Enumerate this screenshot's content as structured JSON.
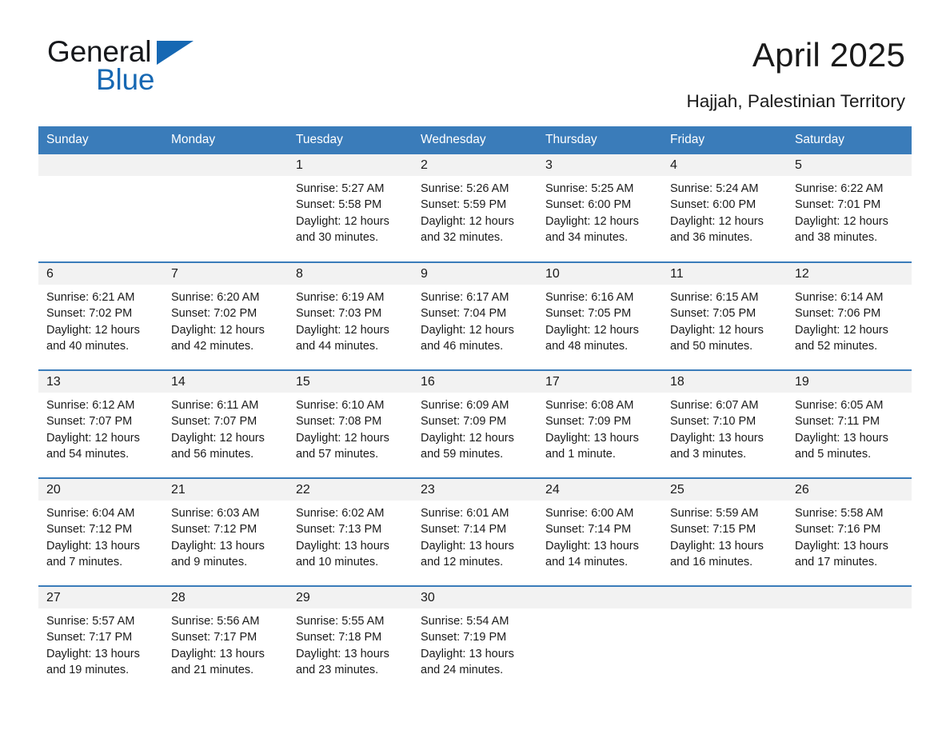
{
  "brand": {
    "name_part1": "General",
    "name_part2": "Blue",
    "triangle_color": "#1668b3",
    "accent_color": "#3a7cba"
  },
  "header": {
    "title": "April 2025",
    "subtitle": "Hajjah, Palestinian Territory"
  },
  "calendar": {
    "weekday_headers": [
      "Sunday",
      "Monday",
      "Tuesday",
      "Wednesday",
      "Thursday",
      "Friday",
      "Saturday"
    ],
    "weeks": [
      [
        {
          "day": "",
          "sunrise": "",
          "sunset": "",
          "daylight": ""
        },
        {
          "day": "",
          "sunrise": "",
          "sunset": "",
          "daylight": ""
        },
        {
          "day": "1",
          "sunrise": "Sunrise: 5:27 AM",
          "sunset": "Sunset: 5:58 PM",
          "daylight": "Daylight: 12 hours and 30 minutes."
        },
        {
          "day": "2",
          "sunrise": "Sunrise: 5:26 AM",
          "sunset": "Sunset: 5:59 PM",
          "daylight": "Daylight: 12 hours and 32 minutes."
        },
        {
          "day": "3",
          "sunrise": "Sunrise: 5:25 AM",
          "sunset": "Sunset: 6:00 PM",
          "daylight": "Daylight: 12 hours and 34 minutes."
        },
        {
          "day": "4",
          "sunrise": "Sunrise: 5:24 AM",
          "sunset": "Sunset: 6:00 PM",
          "daylight": "Daylight: 12 hours and 36 minutes."
        },
        {
          "day": "5",
          "sunrise": "Sunrise: 6:22 AM",
          "sunset": "Sunset: 7:01 PM",
          "daylight": "Daylight: 12 hours and 38 minutes."
        }
      ],
      [
        {
          "day": "6",
          "sunrise": "Sunrise: 6:21 AM",
          "sunset": "Sunset: 7:02 PM",
          "daylight": "Daylight: 12 hours and 40 minutes."
        },
        {
          "day": "7",
          "sunrise": "Sunrise: 6:20 AM",
          "sunset": "Sunset: 7:02 PM",
          "daylight": "Daylight: 12 hours and 42 minutes."
        },
        {
          "day": "8",
          "sunrise": "Sunrise: 6:19 AM",
          "sunset": "Sunset: 7:03 PM",
          "daylight": "Daylight: 12 hours and 44 minutes."
        },
        {
          "day": "9",
          "sunrise": "Sunrise: 6:17 AM",
          "sunset": "Sunset: 7:04 PM",
          "daylight": "Daylight: 12 hours and 46 minutes."
        },
        {
          "day": "10",
          "sunrise": "Sunrise: 6:16 AM",
          "sunset": "Sunset: 7:05 PM",
          "daylight": "Daylight: 12 hours and 48 minutes."
        },
        {
          "day": "11",
          "sunrise": "Sunrise: 6:15 AM",
          "sunset": "Sunset: 7:05 PM",
          "daylight": "Daylight: 12 hours and 50 minutes."
        },
        {
          "day": "12",
          "sunrise": "Sunrise: 6:14 AM",
          "sunset": "Sunset: 7:06 PM",
          "daylight": "Daylight: 12 hours and 52 minutes."
        }
      ],
      [
        {
          "day": "13",
          "sunrise": "Sunrise: 6:12 AM",
          "sunset": "Sunset: 7:07 PM",
          "daylight": "Daylight: 12 hours and 54 minutes."
        },
        {
          "day": "14",
          "sunrise": "Sunrise: 6:11 AM",
          "sunset": "Sunset: 7:07 PM",
          "daylight": "Daylight: 12 hours and 56 minutes."
        },
        {
          "day": "15",
          "sunrise": "Sunrise: 6:10 AM",
          "sunset": "Sunset: 7:08 PM",
          "daylight": "Daylight: 12 hours and 57 minutes."
        },
        {
          "day": "16",
          "sunrise": "Sunrise: 6:09 AM",
          "sunset": "Sunset: 7:09 PM",
          "daylight": "Daylight: 12 hours and 59 minutes."
        },
        {
          "day": "17",
          "sunrise": "Sunrise: 6:08 AM",
          "sunset": "Sunset: 7:09 PM",
          "daylight": "Daylight: 13 hours and 1 minute."
        },
        {
          "day": "18",
          "sunrise": "Sunrise: 6:07 AM",
          "sunset": "Sunset: 7:10 PM",
          "daylight": "Daylight: 13 hours and 3 minutes."
        },
        {
          "day": "19",
          "sunrise": "Sunrise: 6:05 AM",
          "sunset": "Sunset: 7:11 PM",
          "daylight": "Daylight: 13 hours and 5 minutes."
        }
      ],
      [
        {
          "day": "20",
          "sunrise": "Sunrise: 6:04 AM",
          "sunset": "Sunset: 7:12 PM",
          "daylight": "Daylight: 13 hours and 7 minutes."
        },
        {
          "day": "21",
          "sunrise": "Sunrise: 6:03 AM",
          "sunset": "Sunset: 7:12 PM",
          "daylight": "Daylight: 13 hours and 9 minutes."
        },
        {
          "day": "22",
          "sunrise": "Sunrise: 6:02 AM",
          "sunset": "Sunset: 7:13 PM",
          "daylight": "Daylight: 13 hours and 10 minutes."
        },
        {
          "day": "23",
          "sunrise": "Sunrise: 6:01 AM",
          "sunset": "Sunset: 7:14 PM",
          "daylight": "Daylight: 13 hours and 12 minutes."
        },
        {
          "day": "24",
          "sunrise": "Sunrise: 6:00 AM",
          "sunset": "Sunset: 7:14 PM",
          "daylight": "Daylight: 13 hours and 14 minutes."
        },
        {
          "day": "25",
          "sunrise": "Sunrise: 5:59 AM",
          "sunset": "Sunset: 7:15 PM",
          "daylight": "Daylight: 13 hours and 16 minutes."
        },
        {
          "day": "26",
          "sunrise": "Sunrise: 5:58 AM",
          "sunset": "Sunset: 7:16 PM",
          "daylight": "Daylight: 13 hours and 17 minutes."
        }
      ],
      [
        {
          "day": "27",
          "sunrise": "Sunrise: 5:57 AM",
          "sunset": "Sunset: 7:17 PM",
          "daylight": "Daylight: 13 hours and 19 minutes."
        },
        {
          "day": "28",
          "sunrise": "Sunrise: 5:56 AM",
          "sunset": "Sunset: 7:17 PM",
          "daylight": "Daylight: 13 hours and 21 minutes."
        },
        {
          "day": "29",
          "sunrise": "Sunrise: 5:55 AM",
          "sunset": "Sunset: 7:18 PM",
          "daylight": "Daylight: 13 hours and 23 minutes."
        },
        {
          "day": "30",
          "sunrise": "Sunrise: 5:54 AM",
          "sunset": "Sunset: 7:19 PM",
          "daylight": "Daylight: 13 hours and 24 minutes."
        },
        {
          "day": "",
          "sunrise": "",
          "sunset": "",
          "daylight": ""
        },
        {
          "day": "",
          "sunrise": "",
          "sunset": "",
          "daylight": ""
        },
        {
          "day": "",
          "sunrise": "",
          "sunset": "",
          "daylight": ""
        }
      ]
    ]
  }
}
